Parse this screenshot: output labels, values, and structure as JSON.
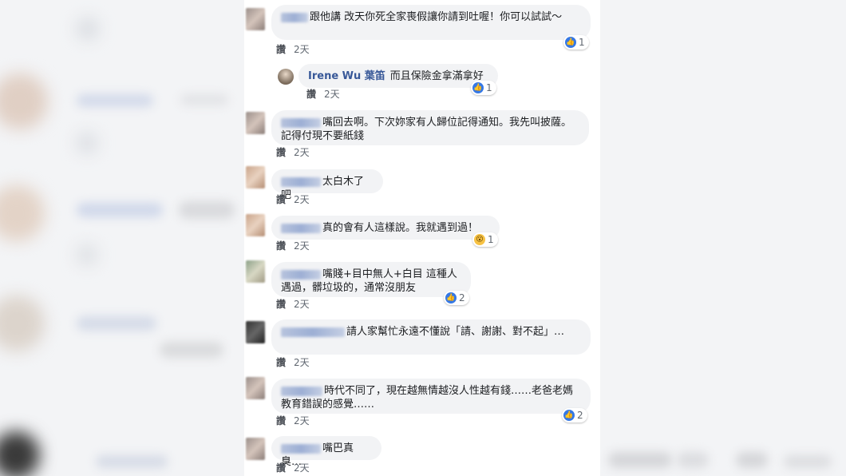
{
  "comments": [
    {
      "text": "跟他講 改天你死全家喪假讓你請到吐喔！你可以試試～",
      "like": "讚",
      "time": "2天",
      "reaction_count": "1"
    },
    {
      "name": "Irene Wu 葉笛",
      "text": "而且保險金拿滿拿好",
      "like": "讚",
      "time": "2天",
      "reaction_count": "1"
    },
    {
      "text": "嘴回去啊。下次妳家有人歸位記得通知。我先叫披薩。記得付現不要紙錢",
      "like": "讚",
      "time": "2天"
    },
    {
      "text": "太白木了吧",
      "like": "讚",
      "time": "2天"
    },
    {
      "text": "真的會有人這樣說。我就遇到過！",
      "like": "讚",
      "time": "2天",
      "reaction_count": "1"
    },
    {
      "text": "嘴賤+目中無人+白目 這種人遇過，髒垃圾的，通常沒朋友",
      "like": "讚",
      "time": "2天",
      "reaction_count": "2"
    },
    {
      "text": "請人家幫忙永遠不懂說「請、謝謝、對不起」…",
      "like": "讚",
      "time": "2天"
    },
    {
      "text": "時代不同了，現在越無情越沒人性越有錢……老爸老媽教育錯誤的感覺……",
      "like": "讚",
      "time": "2天",
      "reaction_count": "2"
    },
    {
      "text": "嘴巴真臭…",
      "like": "讚",
      "time": "2天"
    }
  ],
  "colors": {
    "bubble": "#f2f3f5",
    "link": "#385898",
    "like_blue": "#3578e5"
  }
}
